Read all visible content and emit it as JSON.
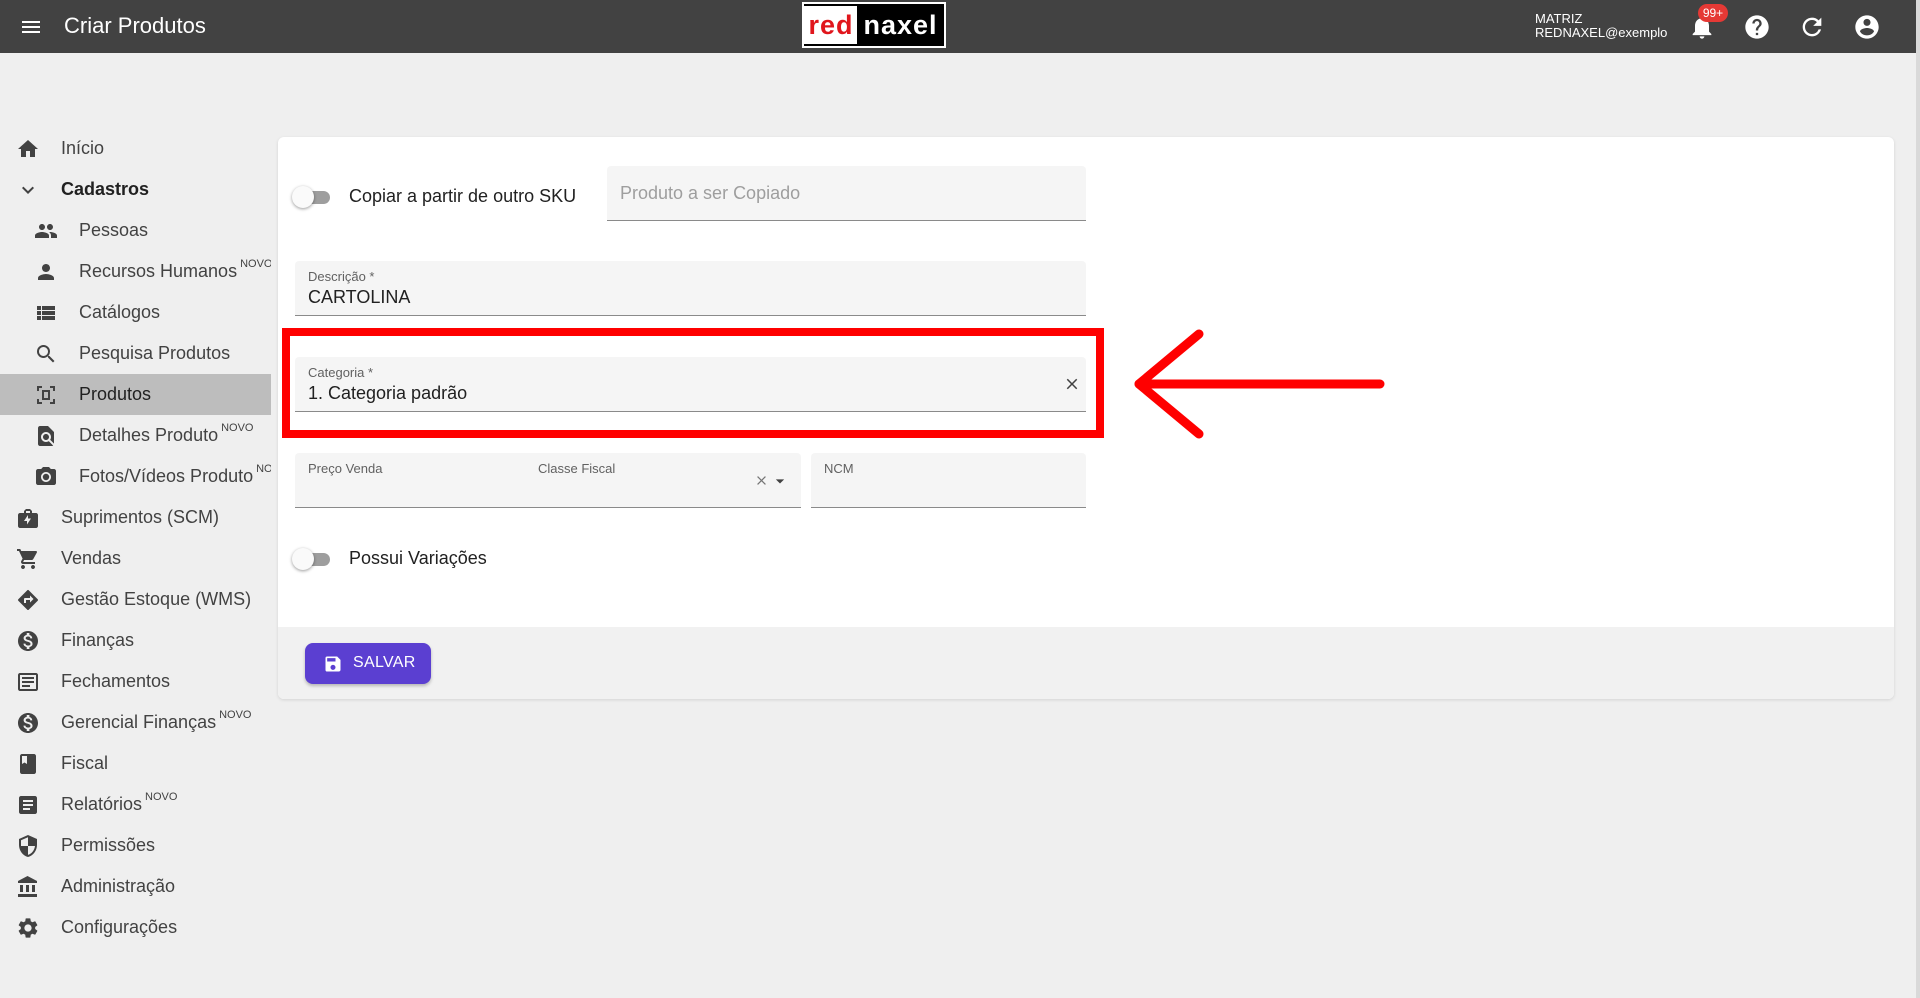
{
  "header": {
    "title": "Criar Produtos",
    "logo_part1": "red",
    "logo_part2": "naxel",
    "company": "MATRIZ",
    "user": "REDNAXEL@exemplo",
    "notification_count": "99+"
  },
  "sidebar": {
    "items": [
      {
        "label": "Início",
        "icon": "home-icon"
      },
      {
        "label": "Cadastros",
        "icon": "chevron-down-icon"
      },
      {
        "label": "Pessoas",
        "icon": "people-icon"
      },
      {
        "label": "Recursos Humanos",
        "badge": "NOVO",
        "icon": "person-icon"
      },
      {
        "label": "Catálogos",
        "icon": "list-icon"
      },
      {
        "label": "Pesquisa Produtos",
        "icon": "search-icon"
      },
      {
        "label": "Produtos",
        "icon": "product-scan-icon",
        "active": true
      },
      {
        "label": "Detalhes Produto",
        "badge": "NOVO",
        "icon": "find-in-page-icon"
      },
      {
        "label": "Fotos/Vídeos Produto",
        "badge": "NOVO",
        "icon": "camera-icon"
      },
      {
        "label": "Suprimentos (SCM)",
        "icon": "supplies-icon"
      },
      {
        "label": "Vendas",
        "icon": "cart-icon"
      },
      {
        "label": "Gestão Estoque (WMS)",
        "icon": "directions-icon"
      },
      {
        "label": "Finanças",
        "icon": "dollar-icon"
      },
      {
        "label": "Fechamentos",
        "icon": "receipt-icon"
      },
      {
        "label": "Gerencial Finanças",
        "badge": "NOVO",
        "icon": "dollar-icon"
      },
      {
        "label": "Fiscal",
        "icon": "book-icon"
      },
      {
        "label": "Relatórios",
        "badge": "NOVO",
        "icon": "report-icon"
      },
      {
        "label": "Permissões",
        "icon": "shield-icon"
      },
      {
        "label": "Administração",
        "icon": "bank-icon"
      },
      {
        "label": "Configurações",
        "icon": "gear-icon"
      }
    ]
  },
  "form": {
    "copy_toggle_label": "Copiar a partir de outro SKU",
    "copy_placeholder": "Produto a ser Copiado",
    "descricao_label": "Descrição *",
    "descricao_value": "CARTOLINA",
    "categoria_label": "Categoria *",
    "categoria_value": "1. Categoria padrão",
    "preco_label": "Preço Venda",
    "classe_label": "Classe Fiscal",
    "ncm_label": "NCM",
    "variacoes_label": "Possui Variações",
    "save_label": "SALVAR"
  },
  "colors": {
    "topbar": "#424242",
    "accent": "#5b3fd1",
    "annotation": "#ff0000"
  }
}
